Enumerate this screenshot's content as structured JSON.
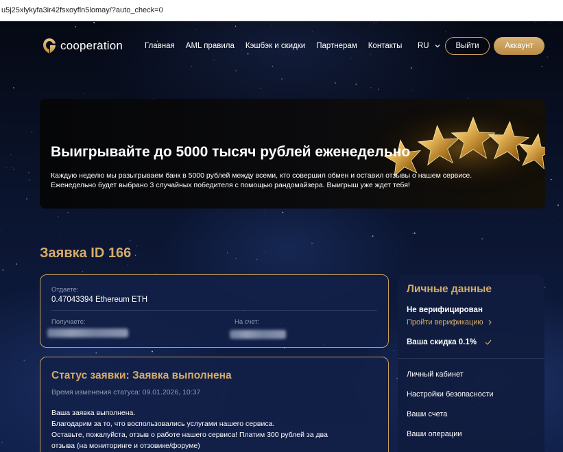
{
  "browser": {
    "url": "u5j25xlykyfa3ir42fsxoyfln5lomay/?auto_check=0"
  },
  "header": {
    "logo_text": "cooperation",
    "nav": [
      "Главная",
      "AML правила",
      "Кэшбэк и скидки",
      "Партнерам",
      "Контакты"
    ],
    "language": "RU",
    "logout_label": "Выйти",
    "account_label": "Аккаунт"
  },
  "banner": {
    "title": "Выигрывайте до 5000 тысяч рублей еженедельно",
    "line1": "Каждую неделю мы разыгрываем банк в 5000 рублей между всеми, кто совершил обмен и оставил отзывы о нашем сервисе.",
    "line2": "Еженедельно будет выбрано 3 случайных победителя с помощью рандомайзера. Выигрыш уже ждет тебя!"
  },
  "order": {
    "title": "Заявка ID 166",
    "give_label": "Отдаете:",
    "give_value": "0.47043394 Ethereum ETH",
    "receive_label": "Получаете:",
    "account_label": "На счет:"
  },
  "status": {
    "title_prefix": "Статус заявки:",
    "title_state": "Заявка выполнена",
    "time": "Время изменения статуса: 09.01.2026, 10:37",
    "body": [
      "Ваша заявка выполнена.",
      "Благодарим за то, что воспользовались услугами нашего сервиса.",
      "Оставьте, пожалуйста, отзыв о работе нашего сервиса! Платим 300 рублей за два",
      "отзыва (на мониторинге и отзовике/форуме)"
    ]
  },
  "sidebar": {
    "title": "Личные данные",
    "verification_status": "Не верифицирован",
    "verify_link": "Пройти верификацию",
    "discount": "Ваша скидка 0.1%",
    "items": [
      "Личный кабинет",
      "Настройки безопасности",
      "Ваши счета",
      "Ваши операции"
    ]
  },
  "colors": {
    "accent": "#d6ac68",
    "background": "#0b1530"
  },
  "icons": [
    "logo-mark-icon",
    "chevron-down-icon",
    "chevron-right-icon",
    "check-icon"
  ]
}
